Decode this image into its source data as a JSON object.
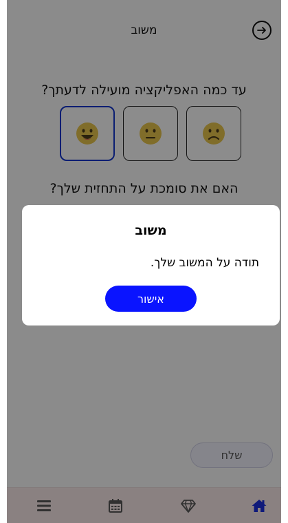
{
  "header": {
    "title": "משוב",
    "back_icon": "arrow-right-circle-icon"
  },
  "questions": {
    "q1": "עד כמה האפליקציה מועילה לדעתך?",
    "q2": "האם את סומכת על התחזית שלך?"
  },
  "rating": {
    "options": [
      "happy-face-icon",
      "neutral-face-icon",
      "sad-face-icon"
    ],
    "selected": "happy-face-icon",
    "face_color": "#e2c04a",
    "selected_border_color": "#1233c8"
  },
  "send_button": {
    "label": "שלח"
  },
  "tabbar": {
    "items": [
      "menu-icon",
      "calendar-icon",
      "gem-icon",
      "home-icon"
    ],
    "active": "home-icon",
    "active_color": "#1c2fd6"
  },
  "dialog": {
    "title": "משוב",
    "message": "תודה על המשוב שלך.",
    "confirm_label": "אישור",
    "button_color": "#0a14ff"
  }
}
